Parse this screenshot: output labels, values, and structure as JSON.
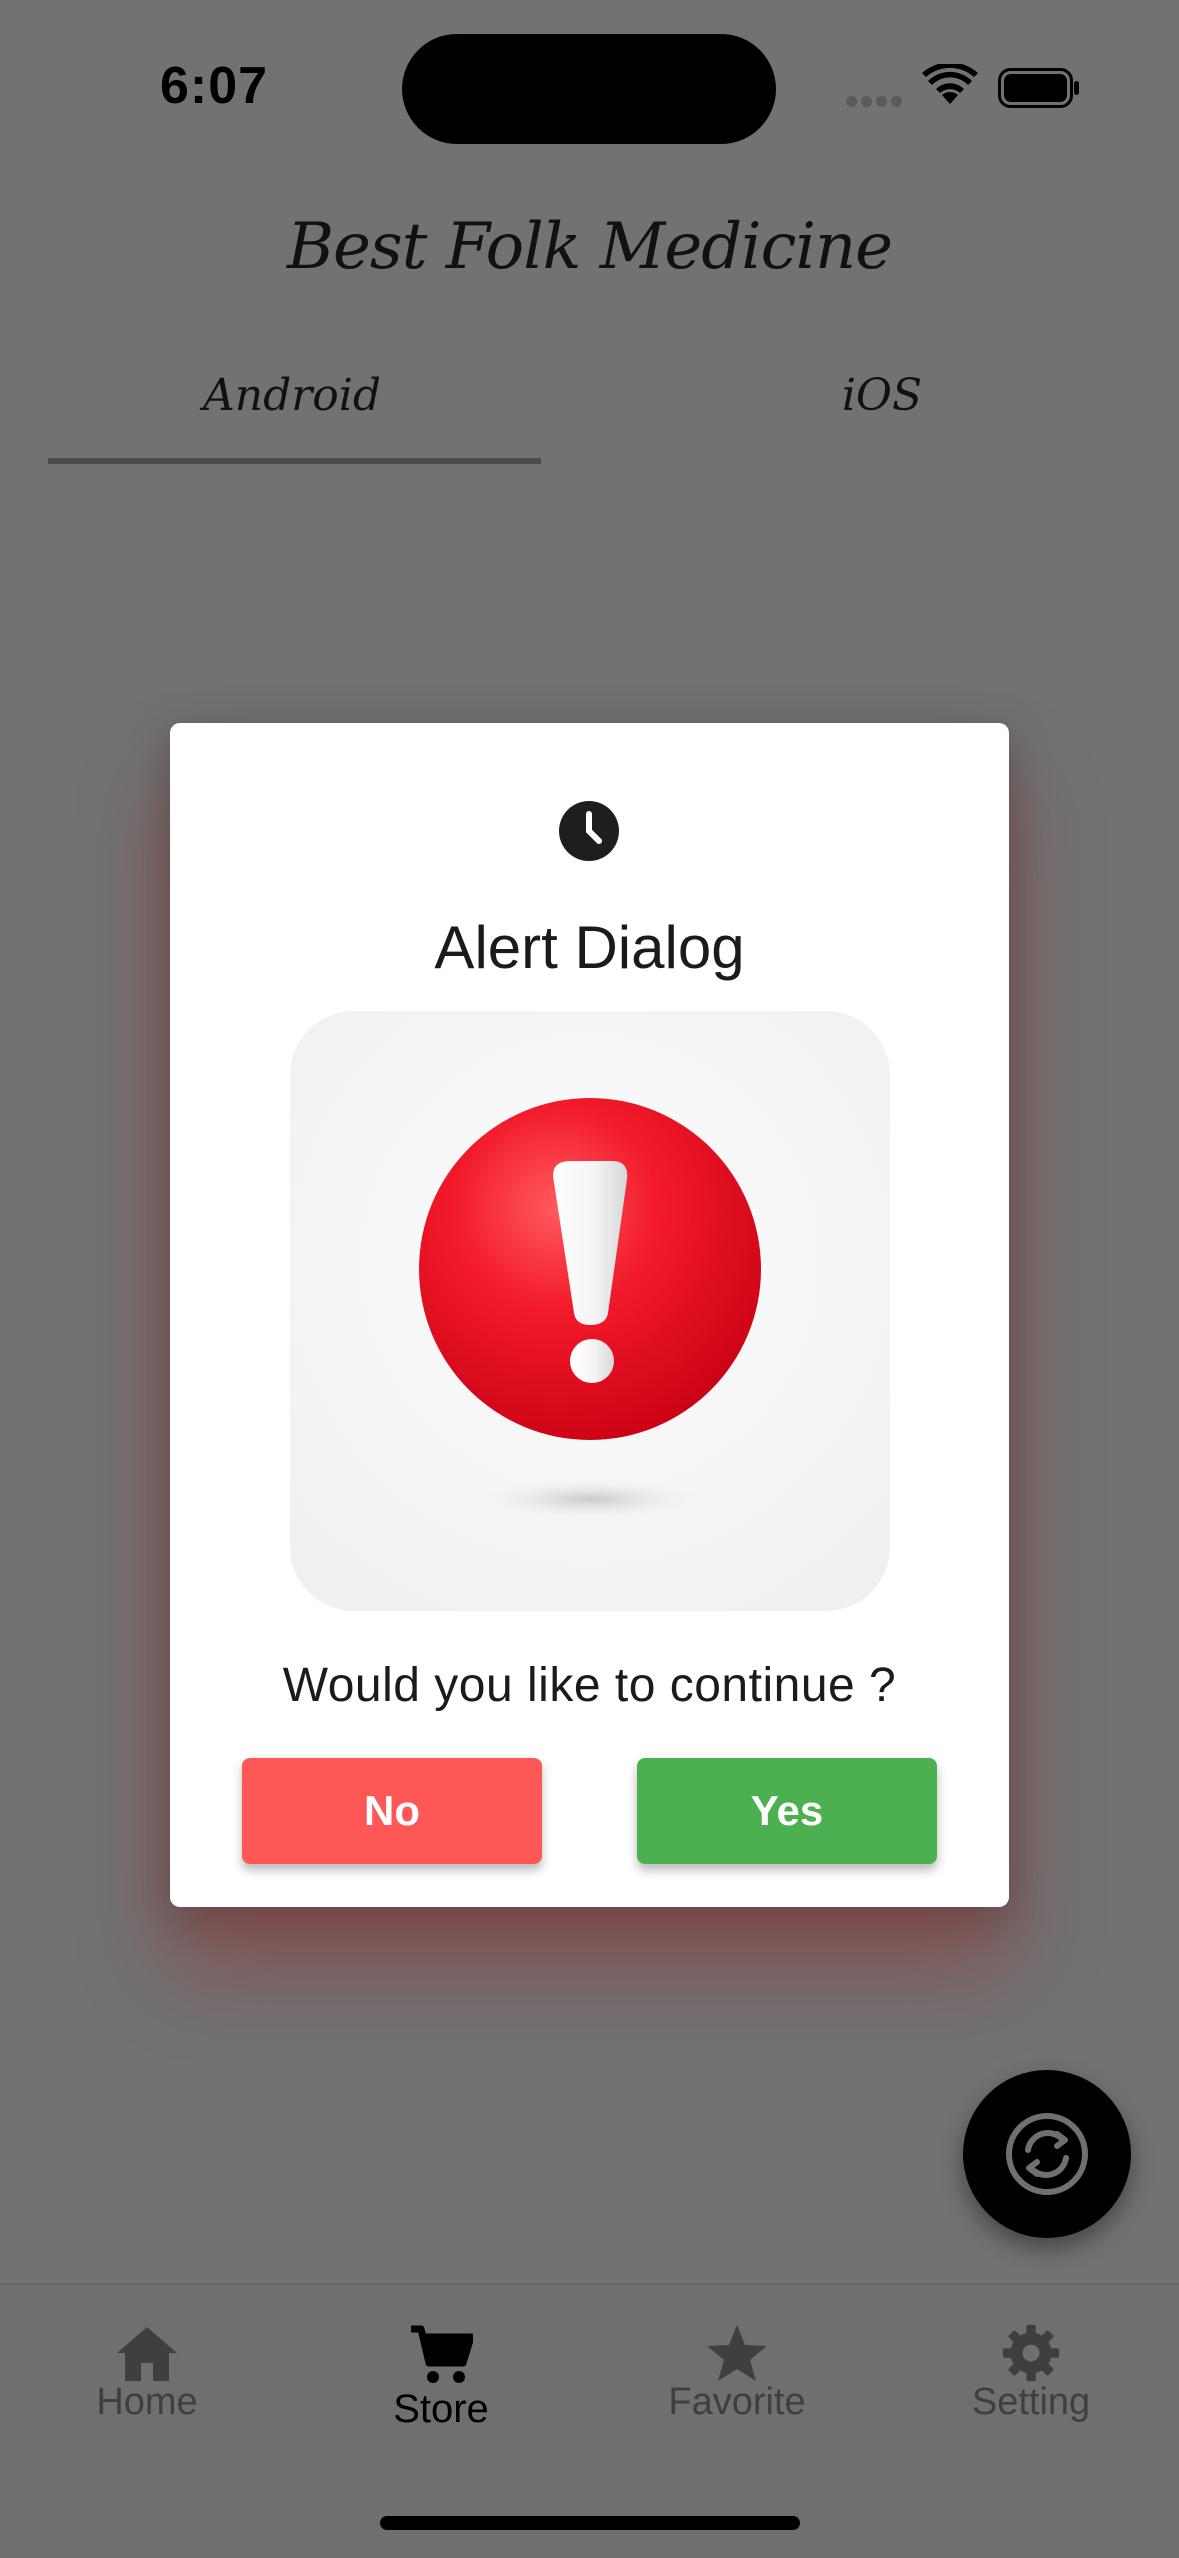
{
  "status_bar": {
    "time": "6:07"
  },
  "app": {
    "title": "Best Folk Medicine",
    "tabs": [
      {
        "label": "Android",
        "selected": true
      },
      {
        "label": "iOS",
        "selected": false
      }
    ]
  },
  "dialog": {
    "title": "Alert Dialog",
    "message": "Would you like to continue ?",
    "no_label": "No",
    "yes_label": "Yes",
    "header_icon": "clock-icon",
    "image": "red-exclamation-alert"
  },
  "fab": {
    "icon": "refresh-icon"
  },
  "bottom_nav": {
    "items": [
      {
        "label": "Home",
        "icon": "home-icon"
      },
      {
        "label": "Store",
        "icon": "cart-icon",
        "selected": true
      },
      {
        "label": "Favorite",
        "icon": "star-icon"
      },
      {
        "label": "Setting",
        "icon": "gear-icon"
      }
    ]
  },
  "colors": {
    "scrim": "#727272",
    "no_button": "#ff5656",
    "yes_button": "#4caf50",
    "alert_red": "#ee1b2e"
  }
}
